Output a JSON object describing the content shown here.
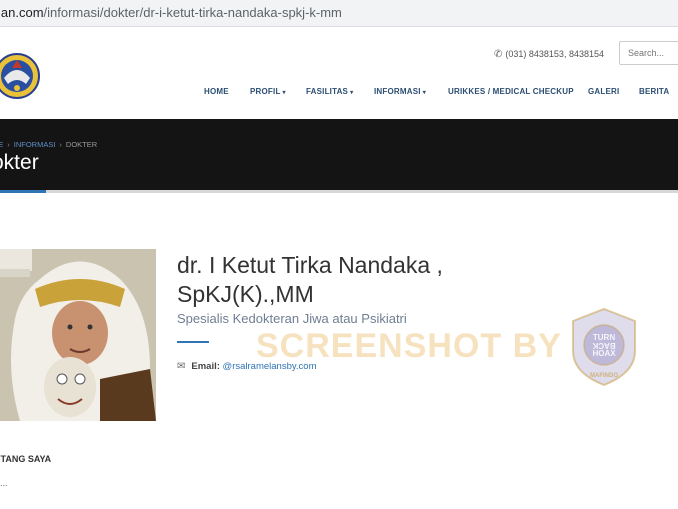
{
  "browser": {
    "url_prefix": "lan.com",
    "url_path": "/informasi/dokter/dr-i-ketut-tirka-nandaka-spkj-k-mm"
  },
  "header": {
    "phone": "(031) 8438153, 8438154",
    "search_placeholder": "Search..."
  },
  "nav": {
    "items": [
      {
        "label": "HOME",
        "caret": ""
      },
      {
        "label": "PROFIL",
        "caret": "▾"
      },
      {
        "label": "FASILITAS",
        "caret": "▾"
      },
      {
        "label": "INFORMASI",
        "caret": "▾"
      },
      {
        "label": "URIKKES / MEDICAL CHECKUP",
        "caret": ""
      },
      {
        "label": "GALERI",
        "caret": ""
      },
      {
        "label": "BERITA",
        "caret": ""
      }
    ]
  },
  "banner": {
    "crumbs": [
      "ME",
      "INFORMASI",
      "DOKTER"
    ],
    "title": "okter"
  },
  "doctor": {
    "name": "dr. I Ketut Tirka Nandaka , SpKJ(K).,MM",
    "specialty": "Spesialis Kedokteran Jiwa atau Psikiatri",
    "email_label": "Email:",
    "email": "@rsalramelansby.com"
  },
  "watermark": {
    "text": "SCREENSHOT BY",
    "badge_line1": "TURN",
    "badge_line2": "BACK",
    "badge_line3": "HOAX",
    "badge_ring": "MASYARAKAT ANTI FITNAH INDONESIA",
    "badge_bottom": "MAFINDO"
  },
  "about": {
    "heading": "NTANG SAYA",
    "text": "..."
  },
  "colors": {
    "accent": "#2f74b5",
    "nav": "#2b4e72",
    "banner": "#141414"
  }
}
